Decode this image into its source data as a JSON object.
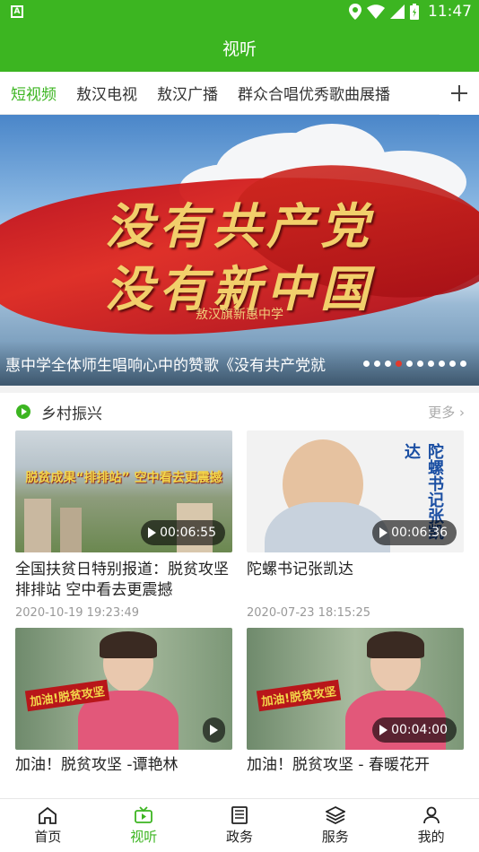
{
  "status_bar": {
    "time": "11:47",
    "notification_icon": "a-icon"
  },
  "header": {
    "title": "视听"
  },
  "tabs": [
    {
      "label": "短视频",
      "active": true
    },
    {
      "label": "敖汉电视",
      "active": false
    },
    {
      "label": "敖汉广播",
      "active": false
    },
    {
      "label": "群众合唱优秀歌曲展播",
      "active": false
    }
  ],
  "tab_add_icon": "plus-icon",
  "banner": {
    "calligraphy_line1": "没有共产党",
    "calligraphy_line2": "没有新中国",
    "subtitle": "敖汉旗新惠中学",
    "caption": "惠中学全体师生唱响心中的赞歌《没有共产党就",
    "dot_count": 10,
    "active_dot": 3
  },
  "section": {
    "title": "乡村振兴",
    "more": "更多 ›"
  },
  "videos": [
    {
      "title": "全国扶贫日特别报道：脱贫攻坚排排站 空中看去更震撼",
      "date": "2020-10-19  19:23:49",
      "duration": "00:06:55",
      "thumb_text": "脱贫成果“排排站” 空中看去更震撼"
    },
    {
      "title": "陀螺书记张凯达",
      "date": "2020-07-23  18:15:25",
      "duration": "00:06:36",
      "thumb_text": "陀螺书记张凯达"
    },
    {
      "title": "加油！脱贫攻坚 -谭艳林",
      "date": "",
      "duration": "",
      "thumb_text": "加油!脱贫攻坚"
    },
    {
      "title": "加油！脱贫攻坚  -  春暖花开",
      "date": "",
      "duration": "00:04:00",
      "thumb_text": "加油!脱贫攻坚"
    }
  ],
  "bottom_nav": [
    {
      "label": "首页",
      "icon": "home-icon",
      "active": false
    },
    {
      "label": "视听",
      "icon": "video-icon",
      "active": true
    },
    {
      "label": "政务",
      "icon": "document-icon",
      "active": false
    },
    {
      "label": "服务",
      "icon": "layers-icon",
      "active": false
    },
    {
      "label": "我的",
      "icon": "user-icon",
      "active": false
    }
  ],
  "colors": {
    "brand_green": "#3cb521",
    "active_dot": "#e23a2c"
  }
}
